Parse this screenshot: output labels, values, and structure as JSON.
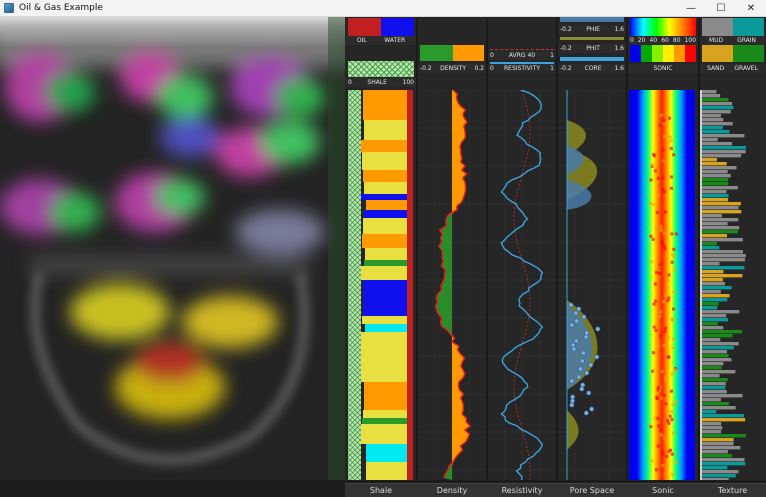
{
  "window": {
    "title": "Oil & Gas Example",
    "minimize": "—",
    "maximize": "☐",
    "close": "✕"
  },
  "tracks": {
    "shale": {
      "legend": [
        "OIL",
        "WATER"
      ],
      "legend_colors": [
        "#c0201f",
        "#1010ee"
      ],
      "scale": {
        "min": "0",
        "name": "SHALE",
        "max": "100"
      },
      "footer": "Shale"
    },
    "density": {
      "scale": {
        "min": "-0.2",
        "name": "DENSITY",
        "max": "0.2"
      },
      "footer": "Density"
    },
    "resistivity": {
      "avg": {
        "min": "0",
        "name": "AVRG 40",
        "max": "1"
      },
      "scale": {
        "min": "0",
        "name": "RESISTIVITY",
        "max": "1"
      },
      "footer": "Resistivity"
    },
    "porespace": {
      "phie": {
        "min": "-0.2",
        "name": "PHIE",
        "max": "1.6"
      },
      "phit": {
        "min": "-0.2",
        "name": "PHIT",
        "max": "1.6"
      },
      "core": {
        "min": "-0.2",
        "name": "CORE",
        "max": "1.6"
      },
      "footer": "Pore Space"
    },
    "sonic": {
      "ticks": [
        "0",
        "20",
        "40",
        "60",
        "80",
        "100"
      ],
      "scale_name": "SONIC",
      "footer": "Sonic"
    },
    "texture": {
      "legend_top": [
        "MUD",
        "GRAIN"
      ],
      "legend_bottom": [
        "SAND",
        "GRAVEL"
      ],
      "legend_colors": [
        "#8a8a8a",
        "#0a9a9a",
        "#d8a420",
        "#1a8a1a"
      ],
      "footer": "Texture"
    }
  },
  "colors": {
    "accent_blue": "#3aa3e0",
    "oil": "#c0201f",
    "water": "#1010ee",
    "density_green": "#2a9a2a",
    "density_orange": "#ff9a00"
  }
}
